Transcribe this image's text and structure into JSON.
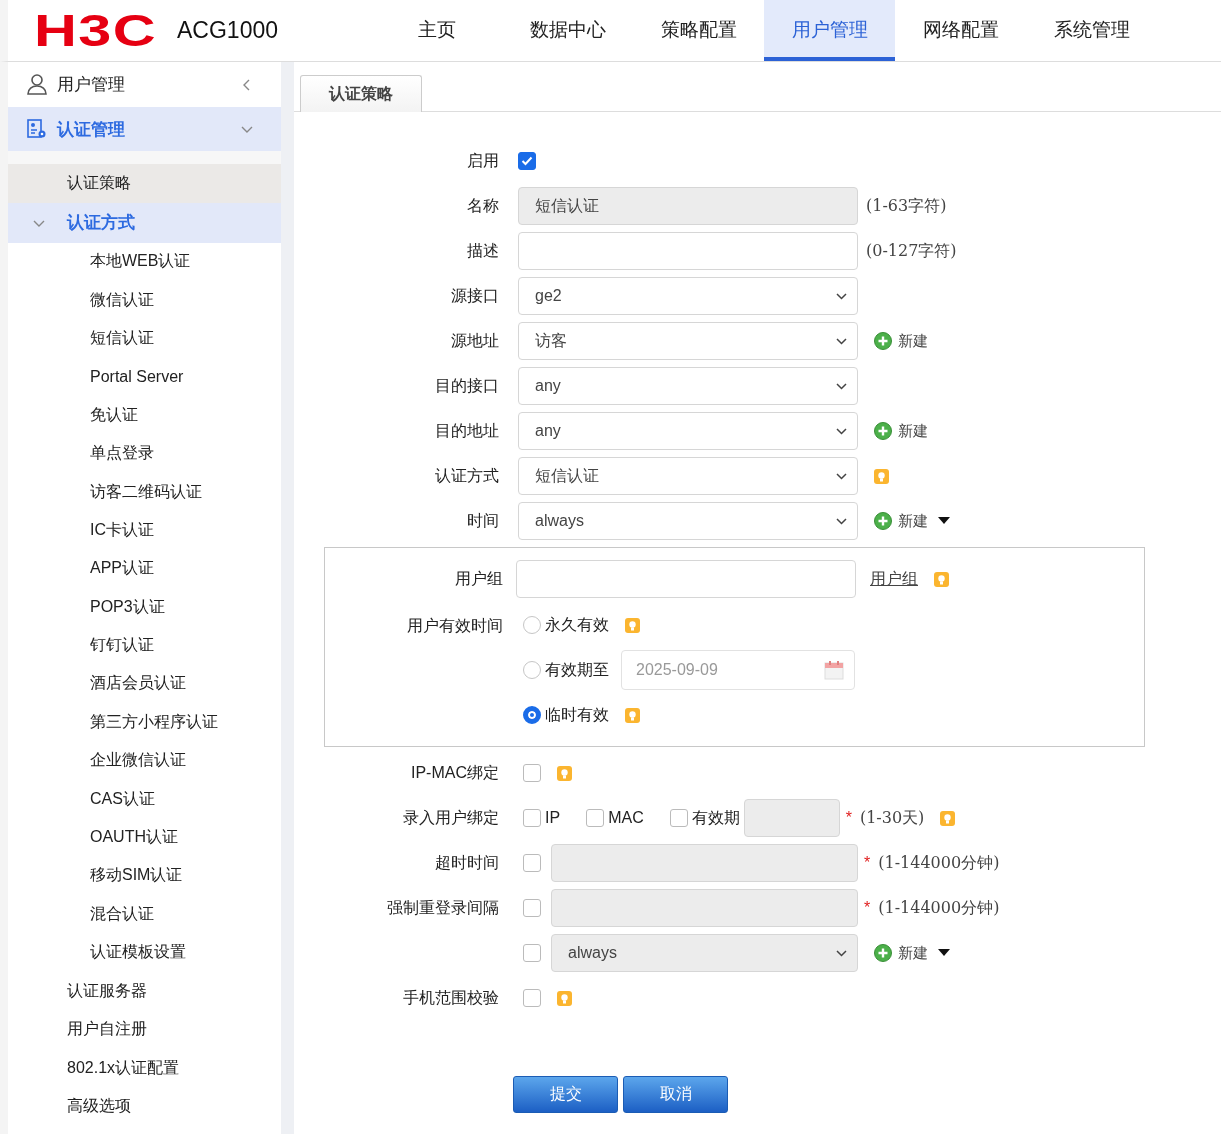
{
  "header": {
    "logo": "H3C",
    "product": "ACG1000"
  },
  "nav": [
    {
      "label": "主页",
      "selected": false
    },
    {
      "label": "数据中心",
      "selected": false
    },
    {
      "label": "策略配置",
      "selected": false
    },
    {
      "label": "用户管理",
      "selected": true
    },
    {
      "label": "网络配置",
      "selected": false
    },
    {
      "label": "系统管理",
      "selected": false
    }
  ],
  "sidebar": {
    "title": "用户管理",
    "section": {
      "label": "认证管理",
      "expanded": true
    },
    "items": [
      {
        "label": "认证策略",
        "selected": true
      },
      {
        "label": "认证方式",
        "selected": false,
        "expanded": true,
        "children": [
          {
            "label": "本地WEB认证"
          },
          {
            "label": "微信认证"
          },
          {
            "label": "短信认证"
          },
          {
            "label": "Portal Server"
          },
          {
            "label": "免认证"
          },
          {
            "label": "单点登录"
          },
          {
            "label": "访客二维码认证"
          },
          {
            "label": "IC卡认证"
          },
          {
            "label": "APP认证"
          },
          {
            "label": "POP3认证"
          },
          {
            "label": "钉钉认证"
          },
          {
            "label": "酒店会员认证"
          },
          {
            "label": "第三方小程序认证"
          },
          {
            "label": "企业微信认证"
          },
          {
            "label": "CAS认证"
          },
          {
            "label": "OAUTH认证"
          },
          {
            "label": "移动SIM认证"
          },
          {
            "label": "混合认证"
          },
          {
            "label": "认证模板设置"
          }
        ]
      },
      {
        "label": "认证服务器",
        "selected": false
      },
      {
        "label": "用户自注册",
        "selected": false
      },
      {
        "label": "802.1x认证配置",
        "selected": false
      },
      {
        "label": "高级选项",
        "selected": false
      }
    ]
  },
  "tabs": [
    {
      "label": "认证策略",
      "selected": true
    }
  ],
  "form": {
    "rows": [
      {
        "kind": "checkbox",
        "label": "启用",
        "checked": true
      },
      {
        "kind": "text",
        "label": "名称",
        "value": "短信认证",
        "disabled": true,
        "hint": "(1-63字符)"
      },
      {
        "kind": "text",
        "label": "描述",
        "disabled": false,
        "hint": "(0-127字符)"
      },
      {
        "kind": "select",
        "label": "源接口",
        "value": "ge2"
      },
      {
        "kind": "select",
        "label": "源地址",
        "value": "访客",
        "action": "新建"
      },
      {
        "kind": "select",
        "label": "目的接口",
        "value": "any"
      },
      {
        "kind": "select",
        "label": "目的地址",
        "value": "any",
        "action": "新建"
      },
      {
        "kind": "select",
        "label": "认证方式",
        "value": "短信认证",
        "help": true
      },
      {
        "kind": "select",
        "label": "时间",
        "value": "always",
        "action": "新建",
        "menu": true
      }
    ],
    "user_box": {
      "group_label": "用户组",
      "group_link": "用户组",
      "group_help": true,
      "validity_label": "用户有效时间",
      "options": [
        {
          "label": "永久有效",
          "selected": false,
          "help": true
        },
        {
          "label": "有效期至",
          "selected": false,
          "date": "2025-09-09"
        },
        {
          "label": "临时有效",
          "selected": true,
          "help": true
        }
      ]
    },
    "lower_rows": [
      {
        "kind": "checkbox",
        "label": "IP-MAC绑定",
        "checked": false,
        "help": true
      },
      {
        "kind": "binding",
        "label": "录入用户绑定",
        "options": [
          {
            "label": "IP",
            "checked": false
          },
          {
            "label": "MAC",
            "checked": false
          },
          {
            "label": "有效期",
            "checked": false
          }
        ],
        "required_mark": "*",
        "hint": "(1-30天)",
        "help": true
      },
      {
        "kind": "check_text",
        "label": "超时时间",
        "checked": false,
        "required_mark": "*",
        "hint": "(1-144000分钟)"
      },
      {
        "kind": "check_text",
        "label": "强制重登录间隔",
        "checked": false,
        "required_mark": "*",
        "hint": "(1-144000分钟)"
      },
      {
        "kind": "check_select",
        "checked": false,
        "value": "always",
        "action": "新建",
        "menu": true
      },
      {
        "kind": "checkbox",
        "label": "手机范围校验",
        "checked": false,
        "help": true
      }
    ]
  },
  "buttons": [
    "提交",
    "取消"
  ]
}
